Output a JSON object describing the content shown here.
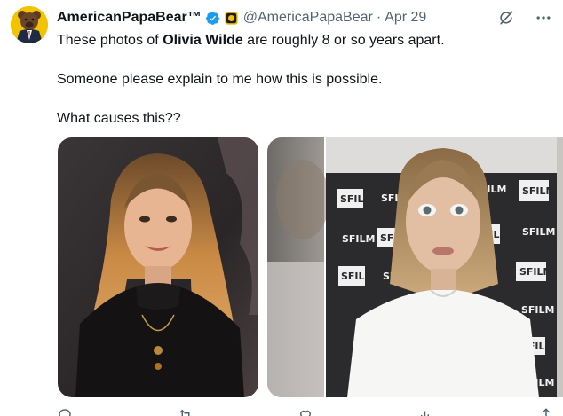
{
  "author": {
    "display_name": "AmericanPapaBear™",
    "handle": "@AmericaPapaBear",
    "separator": "·",
    "date": "Apr 29"
  },
  "tweet": {
    "line1_prefix": "These photos of ",
    "line1_bold": "Olivia Wilde",
    "line1_suffix": " are roughly 8 or so years apart.",
    "line2": "Someone please explain to me how this is possible.",
    "line3": "What causes this??"
  },
  "photo2_wall_logo": "SFILM",
  "icons": {
    "verified": "verified-badge-icon",
    "affiliate": "gold-affiliate-badge-icon",
    "grok": "grok-icon",
    "more": "more-options-icon"
  },
  "colors": {
    "verified_blue": "#1d9bf0",
    "gold": "#e8b500",
    "text_secondary": "#536471"
  }
}
